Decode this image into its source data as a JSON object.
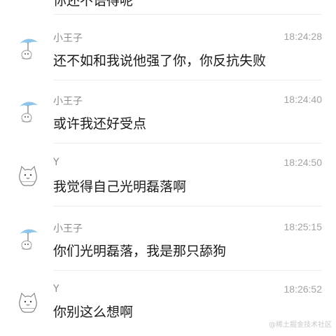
{
  "partial_message": {
    "text": "你还不语得呢"
  },
  "messages": [
    {
      "sender": "小王子",
      "time": "18:24:28",
      "text": "还不如和我说他强了你，你反抗失败",
      "avatar": "umbrella-avatar-icon"
    },
    {
      "sender": "小王子",
      "time": "18:24:40",
      "text": "或许我还好受点",
      "avatar": "umbrella-avatar-icon"
    },
    {
      "sender": "Y",
      "time": "18:24:50",
      "text": "我觉得自己光明磊落啊",
      "avatar": "cat-avatar-icon"
    },
    {
      "sender": "小王子",
      "time": "18:25:15",
      "text": "你们光明磊落，我是那只舔狗",
      "avatar": "umbrella-avatar-icon"
    },
    {
      "sender": "Y",
      "time": "18:26:52",
      "text": "你别这么想啊",
      "avatar": "cat-avatar-icon"
    }
  ],
  "watermark": "@稀土掘金技术社区",
  "colors": {
    "text": "#1a1a1a",
    "meta": "#8a8a8a",
    "time": "#a3a3a3",
    "divider": "#ececec",
    "umbrella": "#8fc5e8"
  }
}
